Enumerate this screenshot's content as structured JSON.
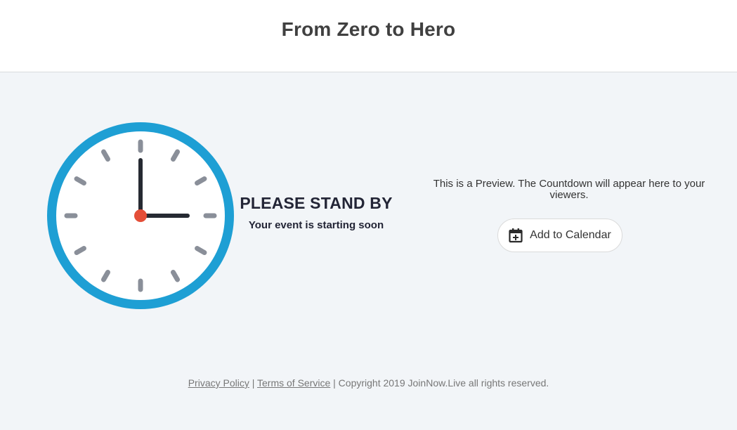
{
  "header": {
    "title": "From Zero to Hero"
  },
  "clock": {
    "icon": "clock-icon",
    "colors": {
      "rim": "#1e9fd4",
      "face": "#ffffff",
      "ticks": "#8a8f99",
      "hands": "#262a32",
      "center": "#e44e38"
    }
  },
  "standby": {
    "title": "PLEASE STAND BY",
    "subtitle": "Your event is starting soon"
  },
  "preview": {
    "text": "This is a Preview. The Countdown will appear here to your viewers."
  },
  "calendar_button": {
    "icon": "calendar-add-icon",
    "label": "Add to Calendar"
  },
  "footer": {
    "privacy": "Privacy Policy",
    "sep1": " | ",
    "terms": "Terms of Service",
    "copyright": " | Copyright 2019 JoinNow.Live all rights reserved."
  }
}
